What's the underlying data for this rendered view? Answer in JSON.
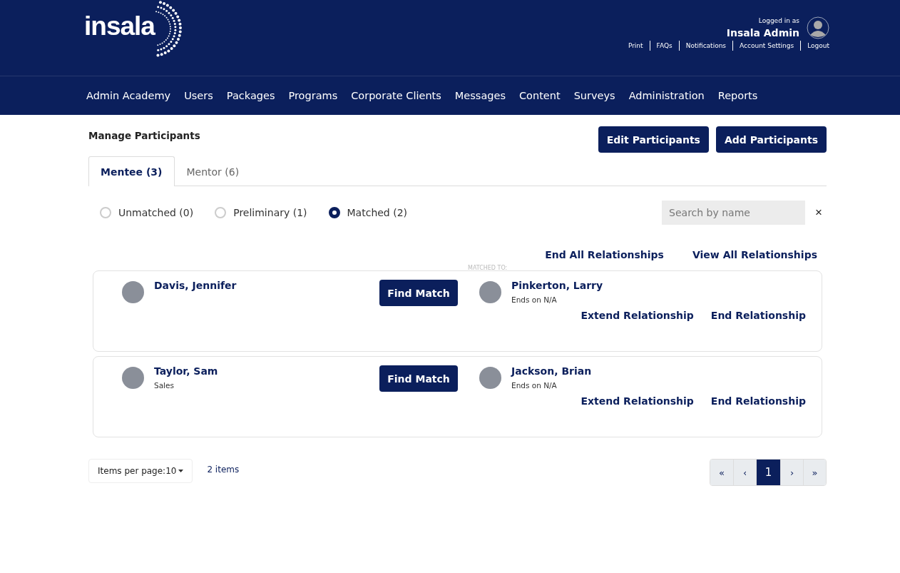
{
  "header": {
    "logo_text": "insala",
    "logged_in_label": "Logged in as",
    "user_name": "Insala Admin",
    "links": [
      "Print",
      "FAQs",
      "Notifications",
      "Account Settings",
      "Logout"
    ]
  },
  "nav": [
    "Admin Academy",
    "Users",
    "Packages",
    "Programs",
    "Corporate Clients",
    "Messages",
    "Content",
    "Surveys",
    "Administration",
    "Reports"
  ],
  "page": {
    "title": "Manage Participants",
    "buttons": [
      "Edit Participants",
      "Add Participants"
    ]
  },
  "tabs": [
    {
      "label": "Mentee (3)",
      "selected": true
    },
    {
      "label": "Mentor (6)",
      "selected": false
    }
  ],
  "filters": [
    {
      "label": "Unmatched (0)",
      "selected": false
    },
    {
      "label": "Preliminary (1)",
      "selected": false
    },
    {
      "label": "Matched (2)",
      "selected": true
    }
  ],
  "search": {
    "placeholder": "Search by name",
    "clear": "×"
  },
  "bulk_actions": [
    "End All Relationships",
    "View All Relationships"
  ],
  "matched_to_label": "MATCHED TO:",
  "participants": [
    {
      "name": "Davis, Jennifer",
      "find_match": "Find Match",
      "match": {
        "name": "Pinkerton, Larry",
        "ends": "Ends on N/A"
      },
      "actions": [
        "Extend Relationship",
        "End Relationship"
      ]
    },
    {
      "name": "Taylor, Sam",
      "department": "Sales",
      "find_match": "Find Match",
      "match": {
        "name": "Jackson, Brian",
        "ends": "Ends on N/A"
      },
      "actions": [
        "Extend Relationship",
        "End Relationship"
      ]
    }
  ],
  "footer": {
    "items_per_page": "Items per page:10",
    "count": "2 items",
    "pagination": [
      {
        "label": "«",
        "selected": false
      },
      {
        "label": "‹",
        "selected": false
      },
      {
        "label": "1",
        "selected": true
      },
      {
        "label": "›",
        "selected": false
      },
      {
        "label": "»",
        "selected": false
      }
    ]
  }
}
